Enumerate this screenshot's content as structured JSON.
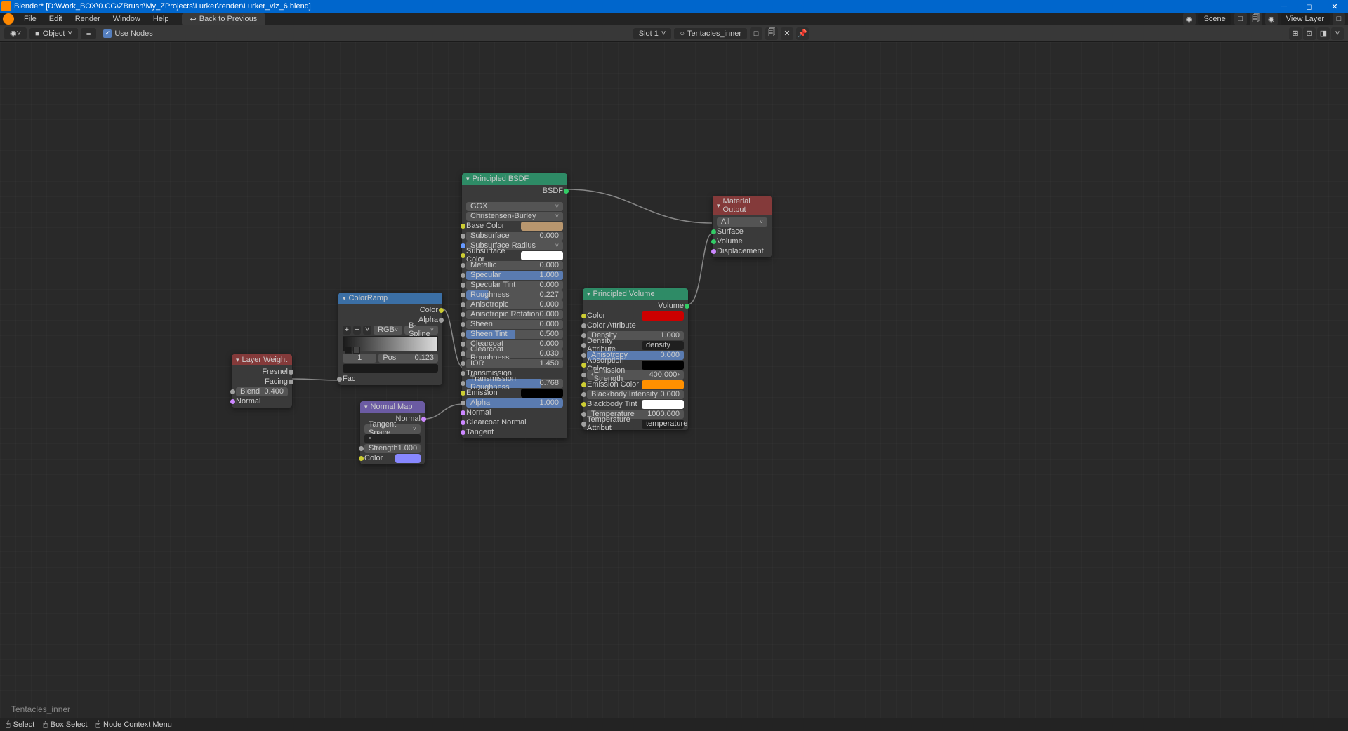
{
  "titlebar": {
    "title": "Blender* [D:\\Work_BOX\\0.CG\\ZBrush\\My_ZProjects\\Lurker\\render\\Lurker_viz_6.blend]"
  },
  "menu": {
    "file": "File",
    "edit": "Edit",
    "render": "Render",
    "window": "Window",
    "help": "Help",
    "back": "Back to Previous"
  },
  "topbar_right": {
    "scene": "Scene",
    "layer": "View Layer"
  },
  "toolbar": {
    "mode": "Object",
    "use_nodes": "Use Nodes",
    "slot": "Slot 1",
    "material": "Tentacles_inner"
  },
  "material_label": "Tentacles_inner",
  "nodes": {
    "layer_weight": {
      "title": "Layer Weight",
      "outputs": {
        "fresnel": "Fresnel",
        "facing": "Facing"
      },
      "blend_label": "Blend",
      "blend_value": "0.400",
      "normal_label": "Normal"
    },
    "color_ramp": {
      "title": "ColorRamp",
      "outputs": {
        "color": "Color",
        "alpha": "Alpha"
      },
      "mode": "RGB",
      "interp": "B-Spline",
      "index": "1",
      "pos_label": "Pos",
      "pos_value": "0.123",
      "fac": "Fac"
    },
    "normal_map": {
      "title": "Normal Map",
      "output": "Normal",
      "space": "Tangent Space",
      "strength_label": "Strength",
      "strength_value": "1.000",
      "color_label": "Color"
    },
    "bsdf": {
      "title": "Principled BSDF",
      "output": "BSDF",
      "dist": "GGX",
      "sss_method": "Christensen-Burley",
      "base_color": "Base Color",
      "subsurface": "Subsurface",
      "subsurface_v": "0.000",
      "ss_radius": "Subsurface Radius",
      "ss_color": "Subsurface Color",
      "metallic": "Metallic",
      "metallic_v": "0.000",
      "specular": "Specular",
      "specular_v": "1.000",
      "spec_tint": "Specular Tint",
      "spec_tint_v": "0.000",
      "roughness": "Roughness",
      "roughness_v": "0.227",
      "aniso": "Anisotropic",
      "aniso_v": "0.000",
      "aniso_rot": "Anisotropic Rotation",
      "aniso_rot_v": "0.000",
      "sheen": "Sheen",
      "sheen_v": "0.000",
      "sheen_tint": "Sheen Tint",
      "sheen_tint_v": "0.500",
      "clearcoat": "Clearcoat",
      "clearcoat_v": "0.000",
      "cc_rough": "Clearcoat Roughness",
      "cc_rough_v": "0.030",
      "ior": "IOR",
      "ior_v": "1.450",
      "transmission": "Transmission",
      "trans_rough": "Transmission Roughness",
      "trans_rough_v": "0.768",
      "emission": "Emission",
      "alpha": "Alpha",
      "alpha_v": "1.000",
      "normal": "Normal",
      "cc_normal": "Clearcoat Normal",
      "tangent": "Tangent"
    },
    "volume": {
      "title": "Principled Volume",
      "output": "Volume",
      "color": "Color",
      "color_attr": "Color Attribute",
      "density": "Density",
      "density_v": "1.000",
      "density_attr": "Density Attribute",
      "density_attr_v": "density",
      "aniso": "Anisotropy",
      "aniso_v": "0.000",
      "absorb": "Absorption Color",
      "emit_str": "Emission Strength",
      "emit_str_v": "400.000",
      "emit_color": "Emission Color",
      "bb_int": "Blackbody Intensity",
      "bb_int_v": "0.000",
      "bb_tint": "Blackbody Tint",
      "temp": "Temperature",
      "temp_v": "1000.000",
      "temp_attr": "Temperature Attribut",
      "temp_attr_v": "temperature"
    },
    "output": {
      "title": "Material Output",
      "target": "All",
      "surface": "Surface",
      "volume": "Volume",
      "displacement": "Displacement"
    }
  },
  "status": {
    "select": "Select",
    "box": "Box Select",
    "node_context": "Node Context Menu"
  }
}
